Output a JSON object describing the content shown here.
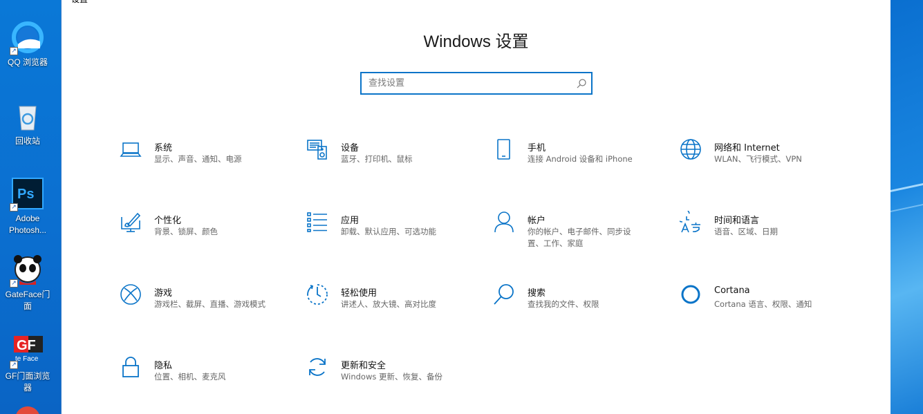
{
  "desktop": {
    "icons": [
      {
        "name": "qq-browser",
        "label": "QQ 浏览器"
      },
      {
        "name": "recycle-bin",
        "label": "回收站"
      },
      {
        "name": "adobe-photoshop",
        "label": "Adobe Photosh..."
      },
      {
        "name": "gateface",
        "label": "GateFace门面"
      },
      {
        "name": "gf-browser",
        "label": "GF门面浏览器",
        "logo_text": "GF",
        "sub_text": "te Face"
      }
    ]
  },
  "window": {
    "title": "设置",
    "page_title": "Windows 设置",
    "search": {
      "placeholder": "查找设置"
    },
    "accent_color": "#0a74c8",
    "tiles": [
      {
        "name": "系统",
        "desc": "显示、声音、通知、电源",
        "icon": "laptop-icon"
      },
      {
        "name": "设备",
        "desc": "蓝牙、打印机、鼠标",
        "icon": "keyboard-speaker-icon"
      },
      {
        "name": "手机",
        "desc": "连接 Android 设备和 iPhone",
        "icon": "phone-icon"
      },
      {
        "name": "网络和 Internet",
        "desc": "WLAN、飞行模式、VPN",
        "icon": "globe-icon"
      },
      {
        "name": "个性化",
        "desc": "背景、锁屏、颜色",
        "icon": "paint-monitor-icon"
      },
      {
        "name": "应用",
        "desc": "卸载、默认应用、可选功能",
        "icon": "apps-list-icon"
      },
      {
        "name": "帐户",
        "desc": "你的帐户、电子邮件、同步设置、工作、家庭",
        "icon": "person-icon"
      },
      {
        "name": "时间和语言",
        "desc": "语音、区域、日期",
        "icon": "time-language-icon"
      },
      {
        "name": "游戏",
        "desc": "游戏栏、截屏、直播、游戏模式",
        "icon": "xbox-icon"
      },
      {
        "name": "轻松使用",
        "desc": "讲述人、放大镜、高对比度",
        "icon": "ease-of-access-icon"
      },
      {
        "name": "搜索",
        "desc": "查找我的文件、权限",
        "icon": "search-icon"
      },
      {
        "name": "Cortana",
        "desc": "Cortana 语言、权限、通知",
        "icon": "cortana-icon"
      },
      {
        "name": "隐私",
        "desc": "位置、相机、麦克风",
        "icon": "lock-icon"
      },
      {
        "name": "更新和安全",
        "desc": "Windows 更新、恢复、备份",
        "icon": "update-icon"
      }
    ]
  }
}
